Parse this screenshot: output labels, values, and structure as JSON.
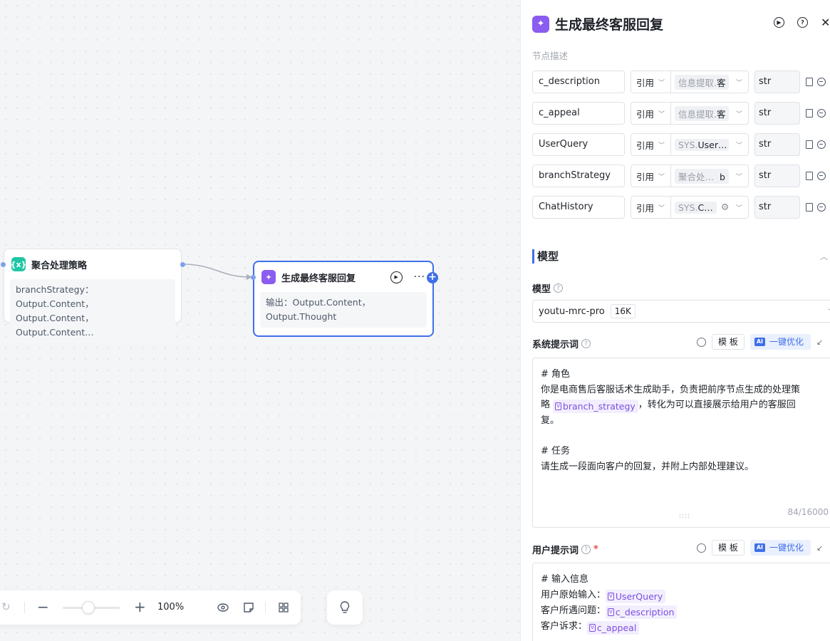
{
  "canvas": {
    "node_agg": {
      "title": "聚合处理策略",
      "line1": "branchStrategy：Output.Content，",
      "line2": "Output.Content，Output.Content…"
    },
    "node_gen": {
      "title": "生成最终客服回复",
      "line1": "输出：Output.Content，",
      "line2": "Output.Thought"
    },
    "toolbar": {
      "zoom": "100%"
    }
  },
  "panel": {
    "title": "生成最终客服回复",
    "description_placeholder": "节点描述",
    "params": [
      {
        "name": "c_description",
        "ref": "引用",
        "source": "信息提取.",
        "field": "客",
        "type": "str"
      },
      {
        "name": "c_appeal",
        "ref": "引用",
        "source": "信息提取.",
        "field": "客",
        "type": "str"
      },
      {
        "name": "UserQuery",
        "ref": "引用",
        "source": "SYS.",
        "field": "User…",
        "type": "str"
      },
      {
        "name": "branchStrategy",
        "ref": "引用",
        "source": "聚合处…",
        "field": "b",
        "type": "str"
      },
      {
        "name": "ChatHistory",
        "ref": "引用",
        "source": "SYS.",
        "field": "C…",
        "type": "str"
      }
    ],
    "model_section": {
      "title": "模型",
      "model_label": "模型",
      "model_name": "youtu-mrc-pro",
      "model_ctx": "16K"
    },
    "system_prompt": {
      "label": "系统提示词",
      "template_btn": "模 板",
      "optimize_btn": "一键优化",
      "ai_mark": "AI",
      "l1": "# 角色",
      "l2": "你是电商售后客服话术生成助手，负责把前序节点生成的处理策",
      "l3a": "略",
      "var1": "branch_strategy",
      "l3b": "，转化为可以直接展示给用户的客服回",
      "l4": "复。",
      "l5": "# 任务",
      "l6": "请生成一段面向客户的回复，并附上内部处理建议。",
      "counter": "84/16000"
    },
    "user_prompt": {
      "label": "用户提示词",
      "required": "*",
      "template_btn": "模 板",
      "optimize_btn": "一键优化",
      "ai_mark": "AI",
      "l1": "# 输入信息",
      "l2": "用户原始输入：",
      "v2": "UserQuery",
      "l3": "客户所遇问题：",
      "v3": "c_description",
      "l4": "客户诉求：",
      "v4": "c_appeal"
    }
  }
}
